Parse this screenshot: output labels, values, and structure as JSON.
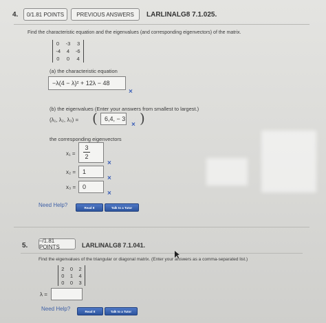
{
  "q4": {
    "number": "4.",
    "points": "0/1.81 POINTS",
    "prev_answers": "PREVIOUS ANSWERS",
    "code": "LARLINALG8 7.1.025.",
    "prompt": "Find the characteristic equation and the eigenvalues (and corresponding eigenvectors) of the matrix.",
    "matrix": [
      [
        "0",
        "-3",
        "3"
      ],
      [
        "-4",
        "4",
        "-6"
      ],
      [
        "0",
        "0",
        "4"
      ]
    ],
    "part_a_label": "(a) the characteristic equation",
    "char_eq_value": "−λ(4 − λ)² + 12λ − 48",
    "part_b_label": "(b) the eigenvalues (Enter your answers from smallest to largest.)",
    "eigen_tuple_label": "(λ₁, λ₂, λ₃) =",
    "eigen_value": "6,4, − 3",
    "eigvec_label": "the corresponding eigenvectors",
    "x1_label": "x₁ =",
    "x1_num": "3",
    "x1_den": "2",
    "x2_label": "x₂ =",
    "x2_value": "1",
    "x3_label": "x₃ =",
    "x3_value": "0",
    "need_help": "Need Help?",
    "read_it": "Read It",
    "talk_tutor": "Talk to a Tutor",
    "x_mark": "×"
  },
  "q5": {
    "number": "5.",
    "points": "–/1.81 POINTS",
    "code": "LARLINALG8 7.1.041.",
    "prompt": "Find the eigenvalues of the triangular or diagonal matrix. (Enter your answers as a comma-separated list.)",
    "matrix": [
      [
        "2",
        "0",
        "2"
      ],
      [
        "0",
        "1",
        "4"
      ],
      [
        "0",
        "0",
        "3"
      ]
    ],
    "lambda_label": "λ =",
    "lambda_value": "",
    "need_help": "Need Help?",
    "read_it": "Read It",
    "talk_tutor": "Talk to a Tutor"
  },
  "colors": {
    "link": "#3d5fa6",
    "button": "#2e559e",
    "x_mark": "#3e61b8"
  }
}
